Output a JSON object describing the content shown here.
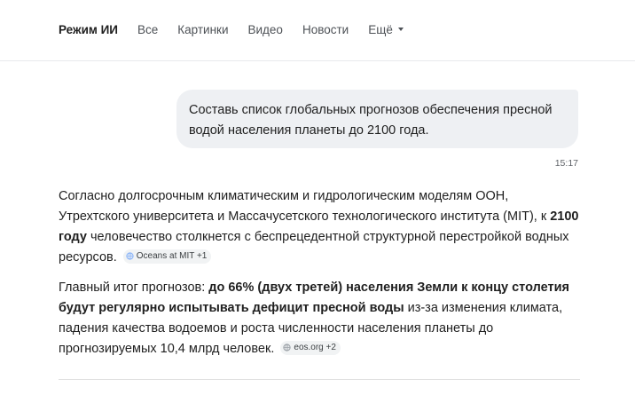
{
  "nav": {
    "tabs": [
      {
        "label": "Режим ИИ"
      },
      {
        "label": "Все"
      },
      {
        "label": "Картинки"
      },
      {
        "label": "Видео"
      },
      {
        "label": "Новости"
      },
      {
        "label": "Ещё"
      }
    ]
  },
  "chat": {
    "user_message": "Составь список глобальных прогнозов обеспечения пресной водой населения планеты до 2100 года.",
    "timestamp": "15:17"
  },
  "answer": {
    "p1": {
      "text1": "Согласно долгосрочным климатическим и гидрологическим моделям ООН, Утрехтского университета и Массачусетского технологического института (MIT), к ",
      "bold1": "2100 году",
      "text2": " человечество столкнется с беспрецедентной структурной перестройкой водных ресурсов.",
      "chip": "Oceans at MIT +1"
    },
    "p2": {
      "text1": "Главный итог прогнозов: ",
      "bold1": "до 66% (двух третей) населения Земли к концу столетия будут регулярно испытывать дефицит пресной воды",
      "text2": " из-за изменения климата, падения качества водоемов и роста численности населения планеты до прогнозируемых 10,4 млрд человек.",
      "chip": "eos.org +2"
    }
  },
  "icons": {
    "source_chip": "globe-icon",
    "more_tab": "caret-down-icon"
  }
}
